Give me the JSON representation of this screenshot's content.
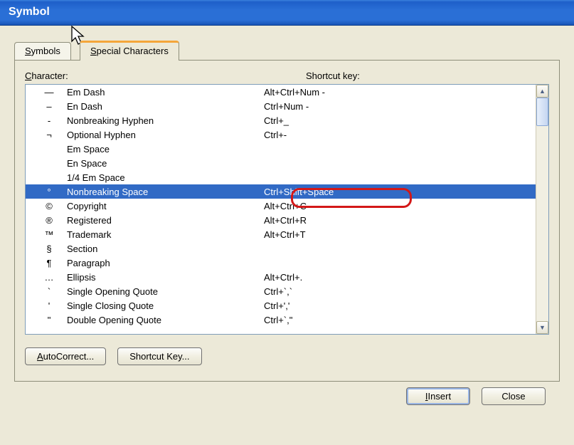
{
  "title": "Symbol",
  "tabs": {
    "symbols": "Symbols",
    "symbols_accel": "S",
    "special": "pecial Characters",
    "special_accel": "S"
  },
  "headers": {
    "character": "Character:",
    "character_accel": "C",
    "shortcut": "Shortcut key:"
  },
  "rows": [
    {
      "sym": "—",
      "name": "Em Dash",
      "key": "Alt+Ctrl+Num -",
      "selected": false
    },
    {
      "sym": "–",
      "name": "En Dash",
      "key": "Ctrl+Num -",
      "selected": false
    },
    {
      "sym": "-",
      "name": "Nonbreaking Hyphen",
      "key": "Ctrl+_",
      "selected": false
    },
    {
      "sym": "¬",
      "name": "Optional Hyphen",
      "key": "Ctrl+-",
      "selected": false
    },
    {
      "sym": "",
      "name": "Em Space",
      "key": "",
      "selected": false
    },
    {
      "sym": "",
      "name": "En Space",
      "key": "",
      "selected": false
    },
    {
      "sym": "",
      "name": "1/4 Em Space",
      "key": "",
      "selected": false
    },
    {
      "sym": "°",
      "name": "Nonbreaking Space",
      "key": "Ctrl+Shift+Space",
      "selected": true
    },
    {
      "sym": "©",
      "name": "Copyright",
      "key": "Alt+Ctrl+C",
      "selected": false
    },
    {
      "sym": "®",
      "name": "Registered",
      "key": "Alt+Ctrl+R",
      "selected": false
    },
    {
      "sym": "™",
      "name": "Trademark",
      "key": "Alt+Ctrl+T",
      "selected": false
    },
    {
      "sym": "§",
      "name": "Section",
      "key": "",
      "selected": false
    },
    {
      "sym": "¶",
      "name": "Paragraph",
      "key": "",
      "selected": false
    },
    {
      "sym": "…",
      "name": "Ellipsis",
      "key": "Alt+Ctrl+.",
      "selected": false
    },
    {
      "sym": "`",
      "name": "Single Opening Quote",
      "key": "Ctrl+`,`",
      "selected": false
    },
    {
      "sym": "'",
      "name": "Single Closing Quote",
      "key": "Ctrl+','",
      "selected": false
    },
    {
      "sym": "\"",
      "name": "Double Opening Quote",
      "key": "Ctrl+`,\"",
      "selected": false
    }
  ],
  "buttons": {
    "autocorrect": "utoCorrect...",
    "autocorrect_accel": "A",
    "shortcutkey": "Shortcut Key...",
    "insert": "Insert",
    "insert_accel": "I",
    "close": "Close"
  }
}
